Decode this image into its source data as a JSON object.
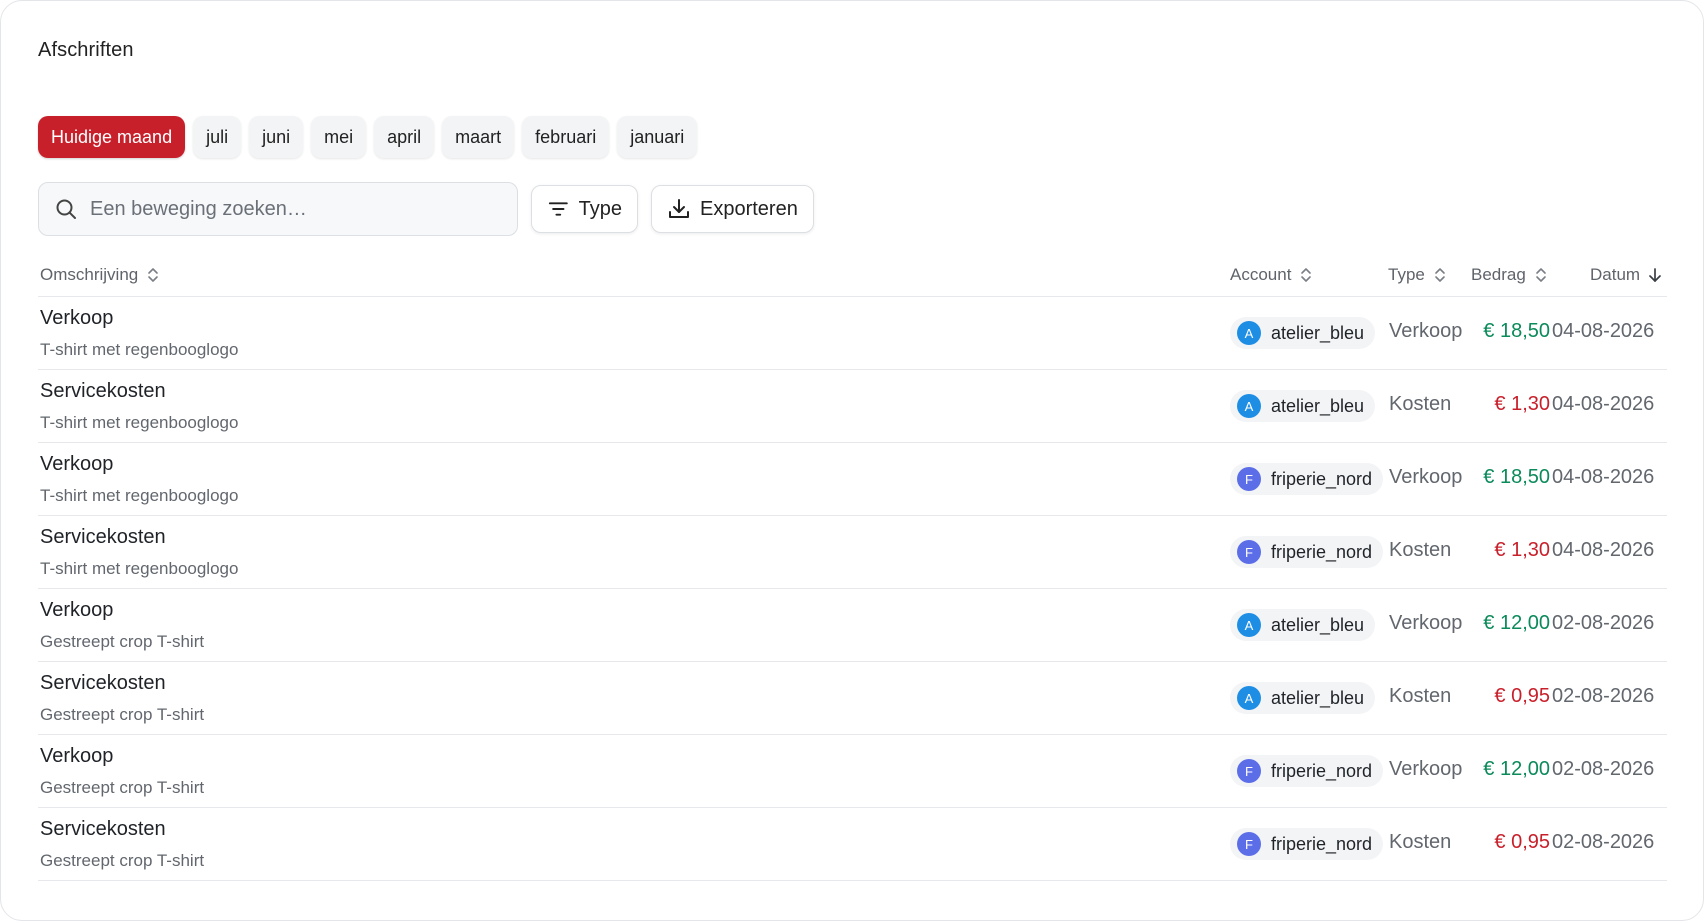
{
  "page": {
    "title": "Afschriften"
  },
  "months": [
    "Huidige maand",
    "juli",
    "juni",
    "mei",
    "april",
    "maart",
    "februari",
    "januari"
  ],
  "active_month": "Huidige maand",
  "search": {
    "placeholder": "Een beweging zoeken…"
  },
  "toolbar": {
    "type_label": "Type",
    "export_label": "Exporteren"
  },
  "columns": {
    "description": "Omschrijving",
    "account": "Account",
    "type": "Type",
    "amount": "Bedrag",
    "date": "Datum"
  },
  "icons": {
    "search": "search-icon",
    "filter": "filter-icon",
    "export": "download-icon",
    "sortable": "sort-icon",
    "sorted": "arrow-down-icon"
  },
  "colors": {
    "accent": "#c8202b",
    "positive": "#0b8a5a",
    "negative": "#c8202b",
    "avatar_a": "#1e8ee5",
    "avatar_f": "#5b6ee8"
  },
  "rows": [
    {
      "title": "Verkoop",
      "subtitle": "T-shirt met regenbooglogo",
      "account": "atelier_bleu",
      "avatar": "A",
      "type": "Verkoop",
      "amount": "€ 18,50",
      "sign": "pos",
      "date": "04-08-2026"
    },
    {
      "title": "Servicekosten",
      "subtitle": "T-shirt met regenbooglogo",
      "account": "atelier_bleu",
      "avatar": "A",
      "type": "Kosten",
      "amount": "€ 1,30",
      "sign": "neg",
      "date": "04-08-2026"
    },
    {
      "title": "Verkoop",
      "subtitle": "T-shirt met regenbooglogo",
      "account": "friperie_nord",
      "avatar": "F",
      "type": "Verkoop",
      "amount": "€ 18,50",
      "sign": "pos",
      "date": "04-08-2026"
    },
    {
      "title": "Servicekosten",
      "subtitle": "T-shirt met regenbooglogo",
      "account": "friperie_nord",
      "avatar": "F",
      "type": "Kosten",
      "amount": "€ 1,30",
      "sign": "neg",
      "date": "04-08-2026"
    },
    {
      "title": "Verkoop",
      "subtitle": "Gestreept crop T-shirt",
      "account": "atelier_bleu",
      "avatar": "A",
      "type": "Verkoop",
      "amount": "€ 12,00",
      "sign": "pos",
      "date": "02-08-2026"
    },
    {
      "title": "Servicekosten",
      "subtitle": "Gestreept crop T-shirt",
      "account": "atelier_bleu",
      "avatar": "A",
      "type": "Kosten",
      "amount": "€ 0,95",
      "sign": "neg",
      "date": "02-08-2026"
    },
    {
      "title": "Verkoop",
      "subtitle": "Gestreept crop T-shirt",
      "account": "friperie_nord",
      "avatar": "F",
      "type": "Verkoop",
      "amount": "€ 12,00",
      "sign": "pos",
      "date": "02-08-2026"
    },
    {
      "title": "Servicekosten",
      "subtitle": "Gestreept crop T-shirt",
      "account": "friperie_nord",
      "avatar": "F",
      "type": "Kosten",
      "amount": "€ 0,95",
      "sign": "neg",
      "date": "02-08-2026"
    }
  ]
}
